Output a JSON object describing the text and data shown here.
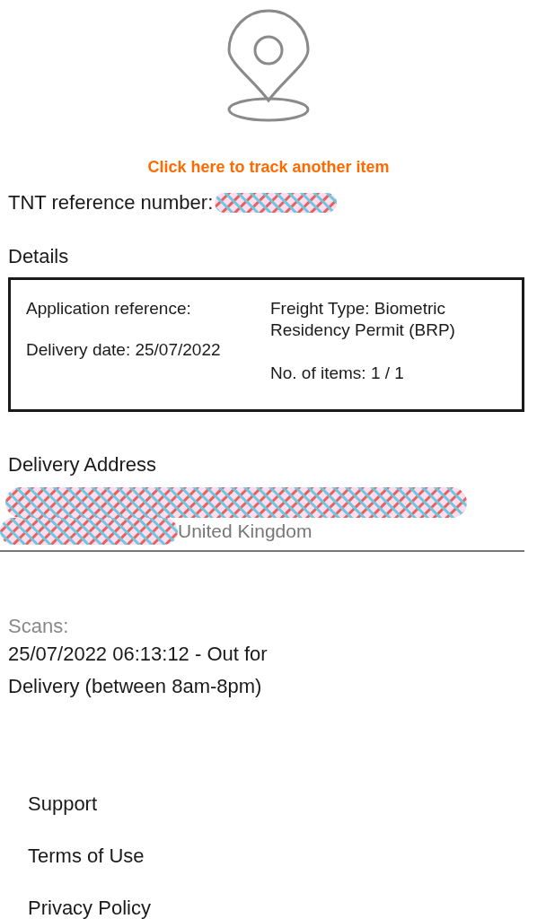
{
  "track_link": "Click here to track another item",
  "reference": {
    "label": "TNT reference number:"
  },
  "details": {
    "title": "Details",
    "left": [
      "Application reference:",
      "Delivery date: 25/07/2022"
    ],
    "right": [
      "Freight Type: Biometric Residency Permit (BRP)",
      "No. of items: 1 / 1"
    ]
  },
  "address": {
    "title": "Delivery Address",
    "country": "United Kingdom"
  },
  "scans": {
    "title": "Scans:",
    "entries": [
      "25/07/2022 06:13:12 - Out for Delivery (between 8am-8pm)"
    ]
  },
  "footer_links": [
    "Support",
    "Terms of Use",
    "Privacy Policy"
  ]
}
